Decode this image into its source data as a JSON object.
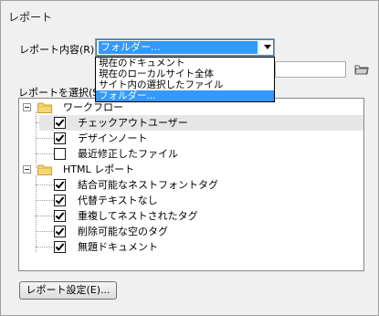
{
  "window": {
    "title": "レポート"
  },
  "report_content": {
    "label": "レポート内容(R) :",
    "selected": "フォルダー...",
    "options": [
      "現在のドキュメント",
      "現在のローカルサイト全体",
      "サイト内の選択したファイル",
      "フォルダー..."
    ],
    "selected_index": 3
  },
  "path_input": {
    "value": ""
  },
  "select_reports": {
    "label": "レポートを選択(S)",
    "groups": [
      {
        "name": "ワークフロー",
        "expanded": true,
        "items": [
          {
            "label": "チェックアウトユーザー",
            "checked": true
          },
          {
            "label": "デザインノート",
            "checked": true
          },
          {
            "label": "最近修正したファイル",
            "checked": false
          }
        ]
      },
      {
        "name": "HTML レポート",
        "expanded": true,
        "items": [
          {
            "label": "結合可能なネストフォントタグ",
            "checked": true
          },
          {
            "label": "代替テキストなし",
            "checked": true
          },
          {
            "label": "重複してネストされたタグ",
            "checked": true
          },
          {
            "label": "削除可能な空のタグ",
            "checked": true
          },
          {
            "label": "無題ドキュメント",
            "checked": true
          }
        ]
      }
    ]
  },
  "report_settings_button": {
    "label": "レポート設定(E)..."
  }
}
